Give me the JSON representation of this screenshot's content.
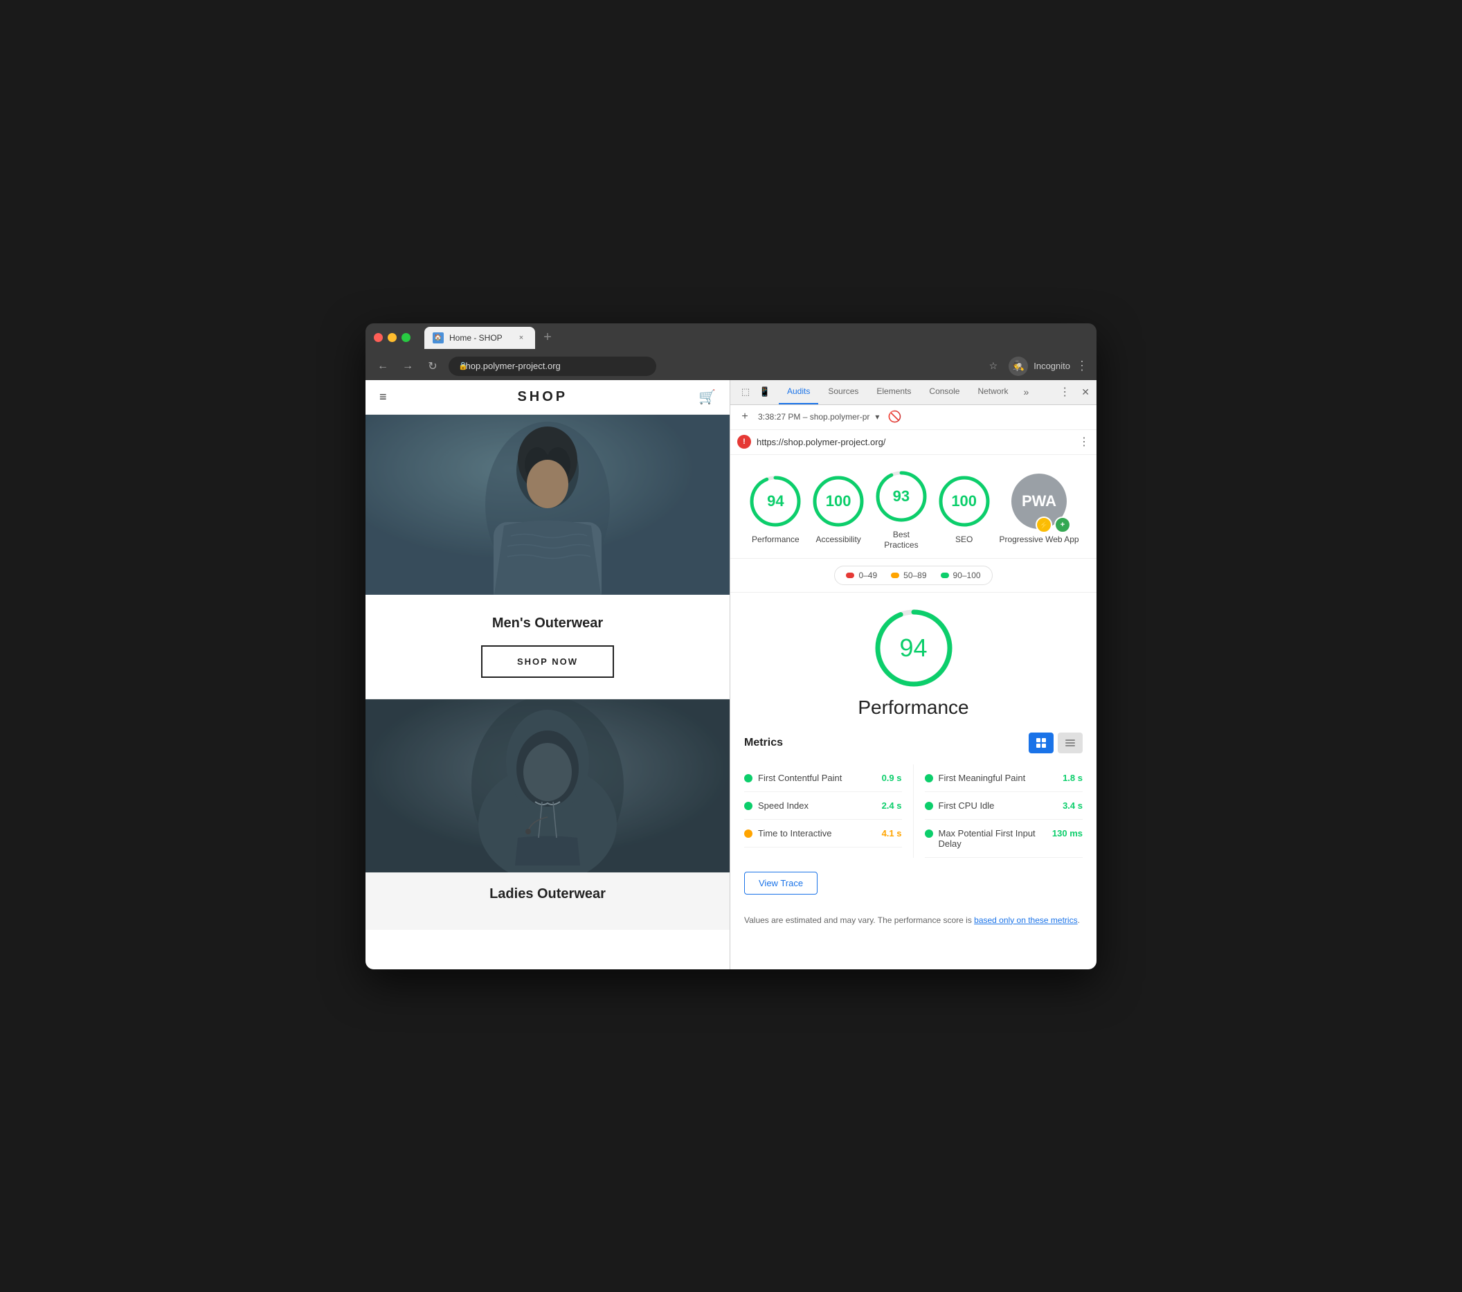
{
  "browser": {
    "tab_title": "Home - SHOP",
    "tab_favicon": "🏠",
    "close_label": "×",
    "new_tab_label": "+",
    "nav_back": "←",
    "nav_forward": "→",
    "nav_refresh": "↻",
    "address_url": "shop.polymer-project.org",
    "star_label": "☆",
    "incognito_label": "Incognito",
    "more_label": "⋮"
  },
  "devtools": {
    "tabs": [
      "Audits",
      "Sources",
      "Elements",
      "Console",
      "Network"
    ],
    "active_tab": "Audits",
    "timestamp": "3:38:27 PM – shop.polymer-pr",
    "report_url": "https://shop.polymer-project.org/",
    "add_label": "+",
    "clear_label": "🚫",
    "more_label": "⋮",
    "overflow_label": "»",
    "close_label": "×",
    "settings_label": "⋮"
  },
  "scores": [
    {
      "value": "94",
      "label": "Performance",
      "color": "#0cce6b",
      "pct": 94
    },
    {
      "value": "100",
      "label": "Accessibility",
      "color": "#0cce6b",
      "pct": 100
    },
    {
      "value": "93",
      "label": "Best Practices",
      "color": "#0cce6b",
      "pct": 93
    },
    {
      "value": "100",
      "label": "SEO",
      "color": "#0cce6b",
      "pct": 100
    }
  ],
  "pwa": {
    "label": "Progressive Web App"
  },
  "legend": [
    {
      "label": "0–49",
      "color": "#e53935"
    },
    {
      "label": "50–89",
      "color": "#ffa400"
    },
    {
      "label": "90–100",
      "color": "#0cce6b"
    }
  ],
  "detail": {
    "score": "94",
    "title": "Performance"
  },
  "metrics": {
    "title": "Metrics",
    "items": [
      {
        "name": "First Contentful Paint",
        "value": "0.9 s",
        "color": "green",
        "side": "left"
      },
      {
        "name": "First Meaningful Paint",
        "value": "1.8 s",
        "color": "green",
        "side": "right"
      },
      {
        "name": "Speed Index",
        "value": "2.4 s",
        "color": "green",
        "side": "left"
      },
      {
        "name": "First CPU Idle",
        "value": "3.4 s",
        "color": "green",
        "side": "right"
      },
      {
        "name": "Time to Interactive",
        "value": "4.1 s",
        "color": "orange",
        "side": "left"
      },
      {
        "name": "Max Potential First Input Delay",
        "value": "130 ms",
        "color": "green",
        "side": "right"
      }
    ]
  },
  "view_trace": {
    "label": "View Trace"
  },
  "footer": {
    "text": "Values are estimated and may vary. The performance score is ",
    "link_text": "based only on these metrics",
    "suffix": "."
  },
  "website": {
    "hamburger": "≡",
    "shop_title": "SHOP",
    "cart": "🛒",
    "men_title": "Men's Outerwear",
    "shop_now": "SHOP NOW",
    "ladies_title": "Ladies Outerwear"
  }
}
